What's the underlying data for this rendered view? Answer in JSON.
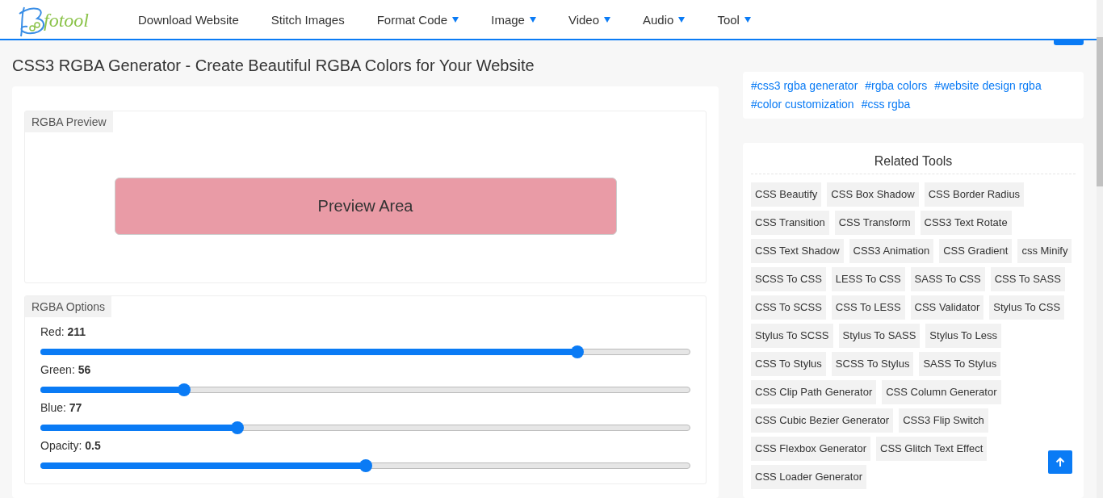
{
  "nav": {
    "logo_text": "fotool",
    "items": [
      {
        "label": "Download Website",
        "dropdown": false
      },
      {
        "label": "Stitch Images",
        "dropdown": false
      },
      {
        "label": "Format Code",
        "dropdown": true
      },
      {
        "label": "Image",
        "dropdown": true
      },
      {
        "label": "Video",
        "dropdown": true
      },
      {
        "label": "Audio",
        "dropdown": true
      },
      {
        "label": "Tool",
        "dropdown": true
      }
    ]
  },
  "page_title": "CSS3 RGBA Generator - Create Beautiful RGBA Colors for Your Website",
  "preview": {
    "legend": "RGBA Preview",
    "text": "Preview Area"
  },
  "options": {
    "legend": "RGBA Options",
    "sliders": [
      {
        "label": "Red:",
        "value": "211",
        "level": 0.827
      },
      {
        "label": "Green:",
        "value": "56",
        "level": 0.22
      },
      {
        "label": "Blue:",
        "value": "77",
        "level": 0.302
      },
      {
        "label": "Opacity:",
        "value": "0.5",
        "level": 0.5
      }
    ]
  },
  "tags": [
    "#css3 rgba generator",
    "#rgba colors",
    "#website design rgba",
    "#color customization",
    "#css rgba"
  ],
  "related": {
    "title": "Related Tools",
    "items": [
      "CSS Beautify",
      "CSS Box Shadow",
      "CSS Border Radius",
      "CSS Transition",
      "CSS Transform",
      "CSS3 Text Rotate",
      "CSS Text Shadow",
      "CSS3 Animation",
      "CSS Gradient",
      "css Minify",
      "SCSS To CSS",
      "LESS To CSS",
      "SASS To CSS",
      "CSS To SASS",
      "CSS To SCSS",
      "CSS To LESS",
      "CSS Validator",
      "Stylus To CSS",
      "Stylus To SCSS",
      "Stylus To SASS",
      "Stylus To Less",
      "CSS To Stylus",
      "SCSS To Stylus",
      "SASS To Stylus",
      "CSS Clip Path Generator",
      "CSS Column Generator",
      "CSS Cubic Bezier Generator",
      "CSS3 Flip Switch",
      "CSS Flexbox Generator",
      "CSS Glitch Text Effect",
      "CSS Loader Generator"
    ]
  }
}
